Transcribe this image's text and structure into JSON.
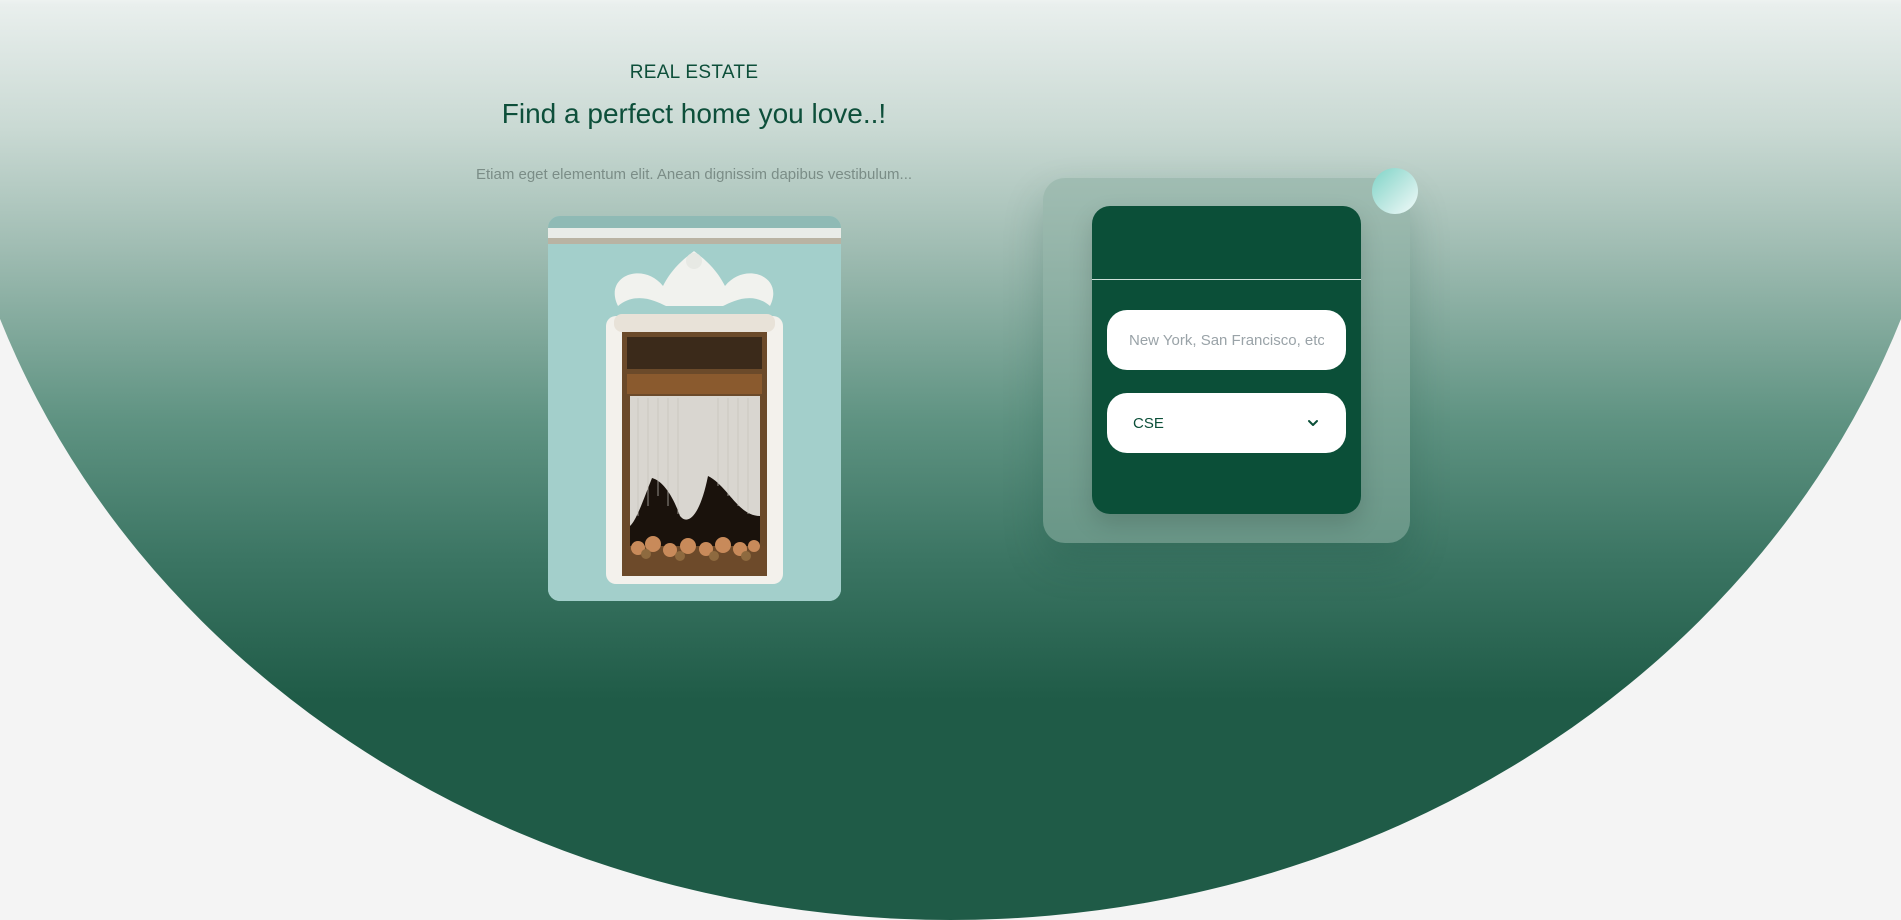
{
  "hero": {
    "eyebrow": "REAL ESTATE",
    "headline": "Find a perfect home you love..!",
    "subtext": "Etiam eget elementum elit. Anean dignissim dapibus vestibulum..."
  },
  "search_form": {
    "location_placeholder": "New York, San Francisco, etc",
    "location_value": "",
    "type_selected": "CSE"
  },
  "colors": {
    "brand_green": "#0b4f38",
    "gradient_bottom": "#1f5b47",
    "accent_mint": "#7fd4c7"
  },
  "icons": {
    "select_chevron": "chevron-down-icon"
  }
}
